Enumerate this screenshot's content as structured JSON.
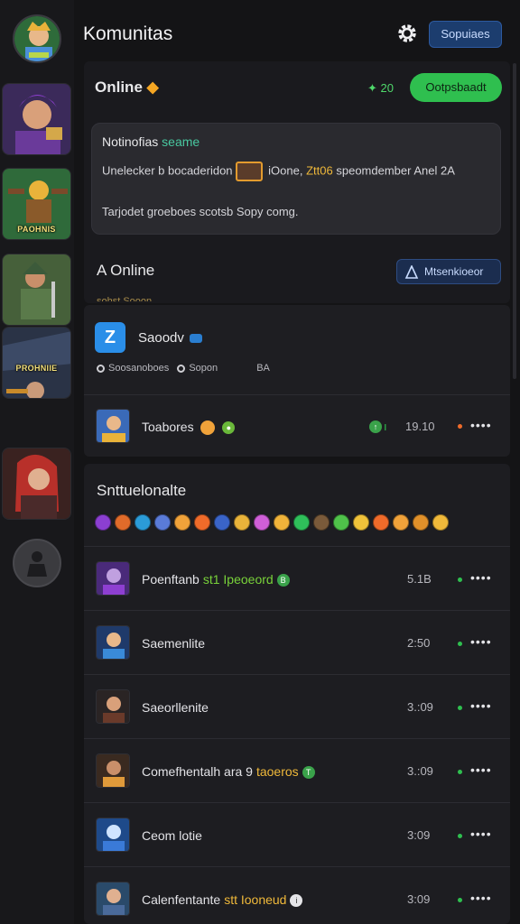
{
  "header": {
    "title": "Komunitas",
    "button_label": "Sopuiaes"
  },
  "online": {
    "title": "Online",
    "count": "20",
    "join_button": "Ootpsbaadt"
  },
  "notification": {
    "heading": "Notinofias",
    "heading_highlight": "seame",
    "line1_a": "Unelecker b bocaderidon",
    "line1_b": "iOone,",
    "line1_highlight": "Ztt06",
    "line1_c": "speomdember Anel 2A",
    "line2": "Tarjodet groeboes scotsb Sopy comg."
  },
  "online_section": {
    "title": "A Online",
    "button_label": "Mtsenkioeor",
    "cut_text": "sohst Sooon"
  },
  "featured": {
    "logo_letter": "Z",
    "name": "Saoodv",
    "meta_label": "Soosanoboes",
    "meta_label2": "Sopon",
    "meta_value": "BA",
    "row": {
      "label": "Toabores",
      "time": "19.10"
    }
  },
  "groups": {
    "title": "Snttuelonalte",
    "emoji_colors": [
      "#8b3fd1",
      "#e06b2a",
      "#2b9bd8",
      "#5a7bd8",
      "#f0a23a",
      "#ef6b2a",
      "#3a64c8",
      "#e9b33a",
      "#cf5fd8",
      "#f0b33a",
      "#2fbf5a",
      "#7a5a3a",
      "#4fc24a",
      "#f0c23a",
      "#ef6b2a",
      "#f0a23a",
      "#e0902a",
      "#f0b93a"
    ],
    "rows": [
      {
        "label": "Poenftanb",
        "tag": "st1 Ipeoeord",
        "tag_color": "green",
        "badge": "B",
        "badge_type": "green",
        "time": "5.1B",
        "dot": "#2fbf4f"
      },
      {
        "label": "Saemenlite",
        "tag": "",
        "tag_color": "",
        "badge": "",
        "badge_type": "",
        "time": "2:50",
        "dot": "#2fbf4f"
      },
      {
        "label": "Saeorllenite",
        "tag": "",
        "tag_color": "",
        "badge": "",
        "badge_type": "",
        "time": "3.:09",
        "dot": "#2fbf4f"
      },
      {
        "label": "Comefhentalh ara 9",
        "tag": "taoeros",
        "tag_color": "orange",
        "badge": "T",
        "badge_type": "green",
        "time": "3.:09",
        "dot": "#2fbf4f"
      },
      {
        "label": "Ceom lotie",
        "tag": "",
        "tag_color": "",
        "badge": "",
        "badge_type": "",
        "time": "3:09",
        "dot": "#2fbf4f"
      },
      {
        "label": "Calenfentante",
        "tag": "stt Iooneud",
        "tag_color": "orange",
        "badge": "i",
        "badge_type": "white",
        "time": "3:09",
        "dot": "#2fbf4f"
      }
    ]
  },
  "rail": {
    "tags": [
      "PAOHNIS",
      "PROHNIIE"
    ]
  },
  "colors": {
    "accent_green": "#2fbf4f",
    "accent_blue": "#1c3d6e",
    "background": "#141416"
  }
}
